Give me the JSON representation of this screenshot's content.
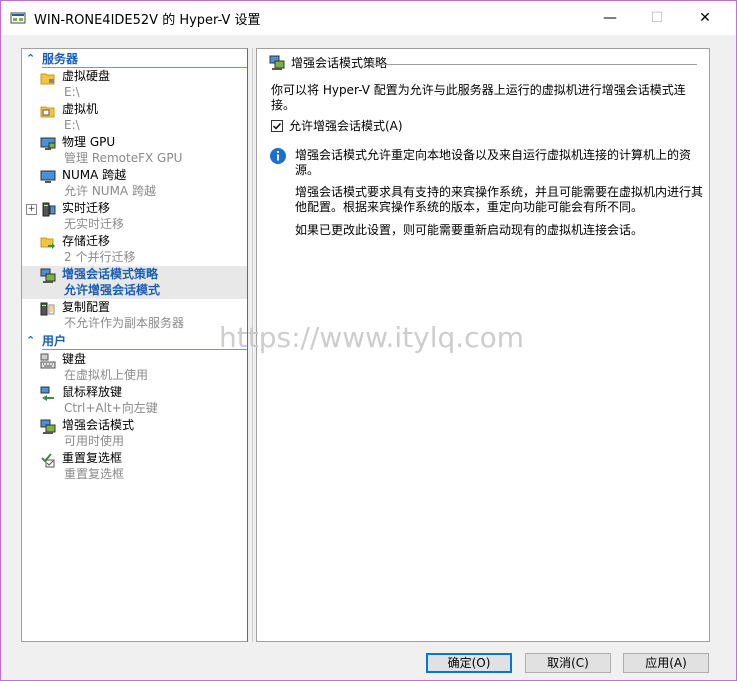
{
  "window": {
    "title": "WIN-RONE4IDE52V 的 Hyper-V 设置",
    "controls": {
      "minimize": "—",
      "maximize": "☐",
      "close": "✕"
    }
  },
  "sidebar": {
    "sections": [
      {
        "label": "服务器",
        "chevron": "⌃"
      },
      {
        "label": "用户",
        "chevron": "⌃"
      }
    ],
    "items": [
      {
        "title": "虚拟硬盘",
        "sub": "E:\\",
        "icon": "folder-disk-icon"
      },
      {
        "title": "虚拟机",
        "sub": "E:\\",
        "icon": "folder-vm-icon"
      },
      {
        "title": "物理 GPU",
        "sub": "管理 RemoteFX GPU",
        "icon": "monitor-gpu-icon"
      },
      {
        "title": "NUMA 跨越",
        "sub": "允许 NUMA 跨越",
        "icon": "numa-monitor-icon"
      },
      {
        "title": "实时迁移",
        "sub": "无实时迁移",
        "icon": "live-migration-icon",
        "expand": "+"
      },
      {
        "title": "存储迁移",
        "sub": "2 个并行迁移",
        "icon": "storage-migration-icon"
      },
      {
        "title": "增强会话模式策略",
        "sub": "允许增强会话模式",
        "icon": "enhanced-session-policy-icon",
        "selected": true
      },
      {
        "title": "复制配置",
        "sub": "不允许作为副本服务器",
        "icon": "replication-icon"
      },
      {
        "title": "键盘",
        "sub": "在虚拟机上使用",
        "icon": "keyboard-icon"
      },
      {
        "title": "鼠标释放键",
        "sub": "Ctrl+Alt+向左键",
        "icon": "mouse-release-icon"
      },
      {
        "title": "增强会话模式",
        "sub": "可用时使用",
        "icon": "enhanced-session-icon"
      },
      {
        "title": "重置复选框",
        "sub": "重置复选框",
        "icon": "reset-checkbox-icon"
      }
    ]
  },
  "main": {
    "header": "增强会话模式策略",
    "description": "你可以将 Hyper-V 配置为允许与此服务器上运行的虚拟机进行增强会话模式连接。",
    "checkbox": {
      "label": "允许增强会话模式(A)",
      "checked": true
    },
    "info": [
      "增强会话模式允许重定向本地设备以及来自运行虚拟机连接的计算机上的资源。",
      "增强会话模式要求具有支持的来宾操作系统，并且可能需要在虚拟机内进行其他配置。根据来宾操作系统的版本，重定向功能可能会有所不同。",
      "如果已更改此设置，则可能需要重新启动现有的虚拟机连接会话。"
    ]
  },
  "buttons": {
    "ok": "确定(O)",
    "cancel": "取消(C)",
    "apply": "应用(A)"
  },
  "watermark": "https://www.itylq.com",
  "colors": {
    "accent": "#1a5fb4",
    "window_border": "#c26fd3",
    "selected_bg": "#e8e8e8"
  }
}
